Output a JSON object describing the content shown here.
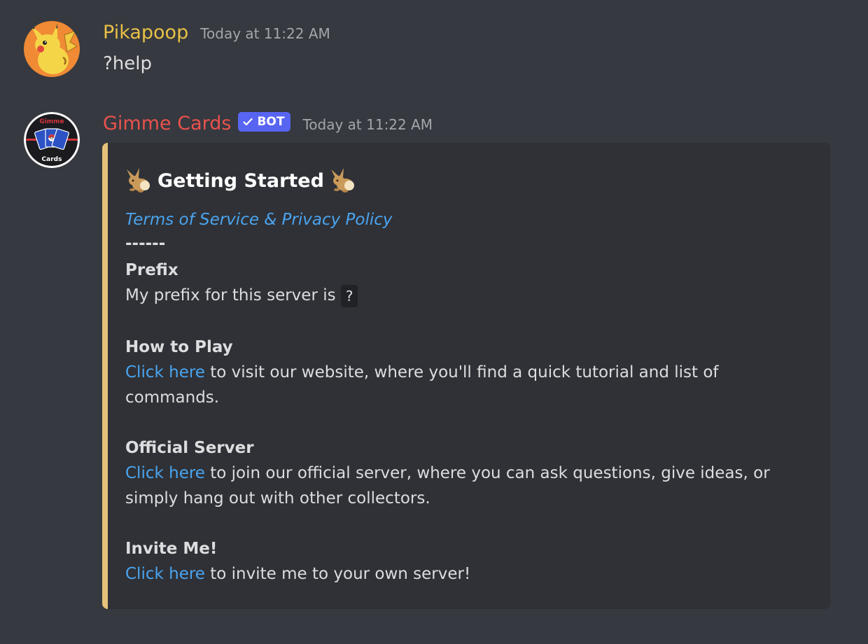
{
  "messages": [
    {
      "username": "Pikapoop",
      "username_color": "#e9c046",
      "timestamp": "Today at 11:22 AM",
      "text": "?help",
      "avatar_icon": "pikachu-avatar-icon"
    },
    {
      "username": "Gimme Cards",
      "username_color": "#e9524d",
      "bot_tag": "BOT",
      "timestamp": "Today at 11:22 AM",
      "avatar_icon": "gimme-cards-logo-icon",
      "avatar_text_top": "Gimme",
      "avatar_text_bottom": "Cards"
    }
  ],
  "embed": {
    "accent_color": "#e7c17b",
    "title": "Getting Started",
    "title_icon": "eevee-icon",
    "tos_link": "Terms of Service & Privacy Policy",
    "divider": "------",
    "prefix_heading": "Prefix",
    "prefix_text": "My prefix for this server is",
    "prefix_value": "?",
    "how_to_play_heading": "How to Play",
    "how_to_play_link": "Click here",
    "how_to_play_text_1": " to visit our website, where you'll find a quick tutorial and list of",
    "how_to_play_text_2": "commands.",
    "official_server_heading": "Official Server",
    "official_server_link": "Click here",
    "official_server_text_1": " to join our official server, where you can ask questions, give ideas, or",
    "official_server_text_2": "simply hang out with other collectors.",
    "invite_heading": "Invite Me!",
    "invite_link": "Click here",
    "invite_text": " to invite me to your own server!"
  }
}
